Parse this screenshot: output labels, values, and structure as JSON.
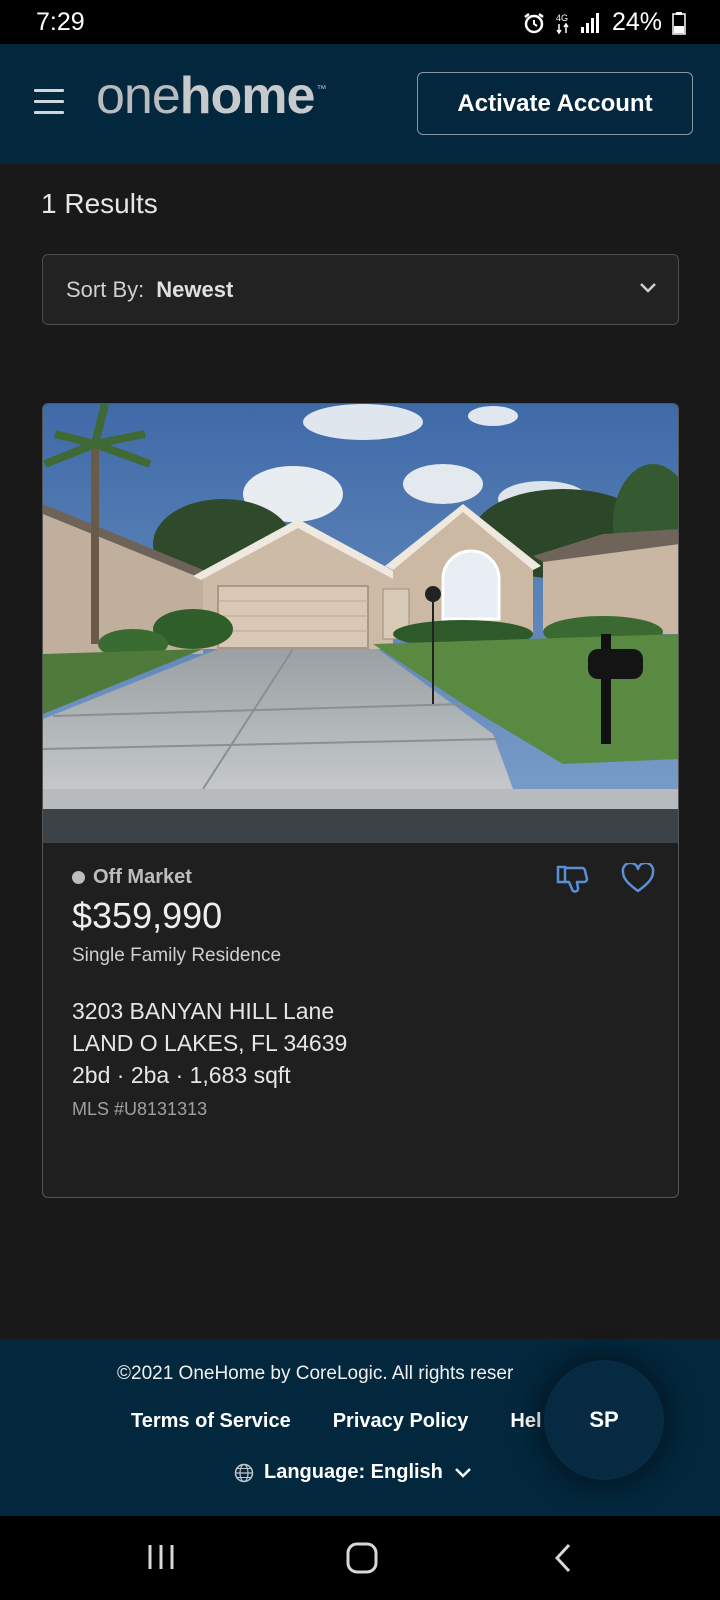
{
  "status_bar": {
    "time": "7:29",
    "battery": "24%"
  },
  "header": {
    "logo": {
      "part1": "one",
      "part2": "home",
      "tm": "™"
    },
    "activate_button": "Activate Account"
  },
  "results": {
    "count_text": "1 Results"
  },
  "sort": {
    "label": "Sort By:",
    "value": "Newest"
  },
  "listing": {
    "status": "Off Market",
    "price": "$359,990",
    "property_type": "Single Family Residence",
    "address_line1": "3203 BANYAN HILL Lane",
    "address_line2": "LAND O LAKES, FL 34639",
    "specs": "2bd · 2ba · 1,683 sqft",
    "mls": "MLS #U8131313"
  },
  "footer": {
    "copyright": "©2021 OneHome by CoreLogic. All rights reser",
    "links": [
      "Terms of Service",
      "Privacy Policy",
      "Hel"
    ],
    "language": "Language: English"
  },
  "chat_bubble": {
    "initials": "SP"
  },
  "colors": {
    "header_bg": "#03273d",
    "page_bg": "#191919",
    "card_bg": "#1f1f1f",
    "accent_icon": "#5b8fd6"
  }
}
